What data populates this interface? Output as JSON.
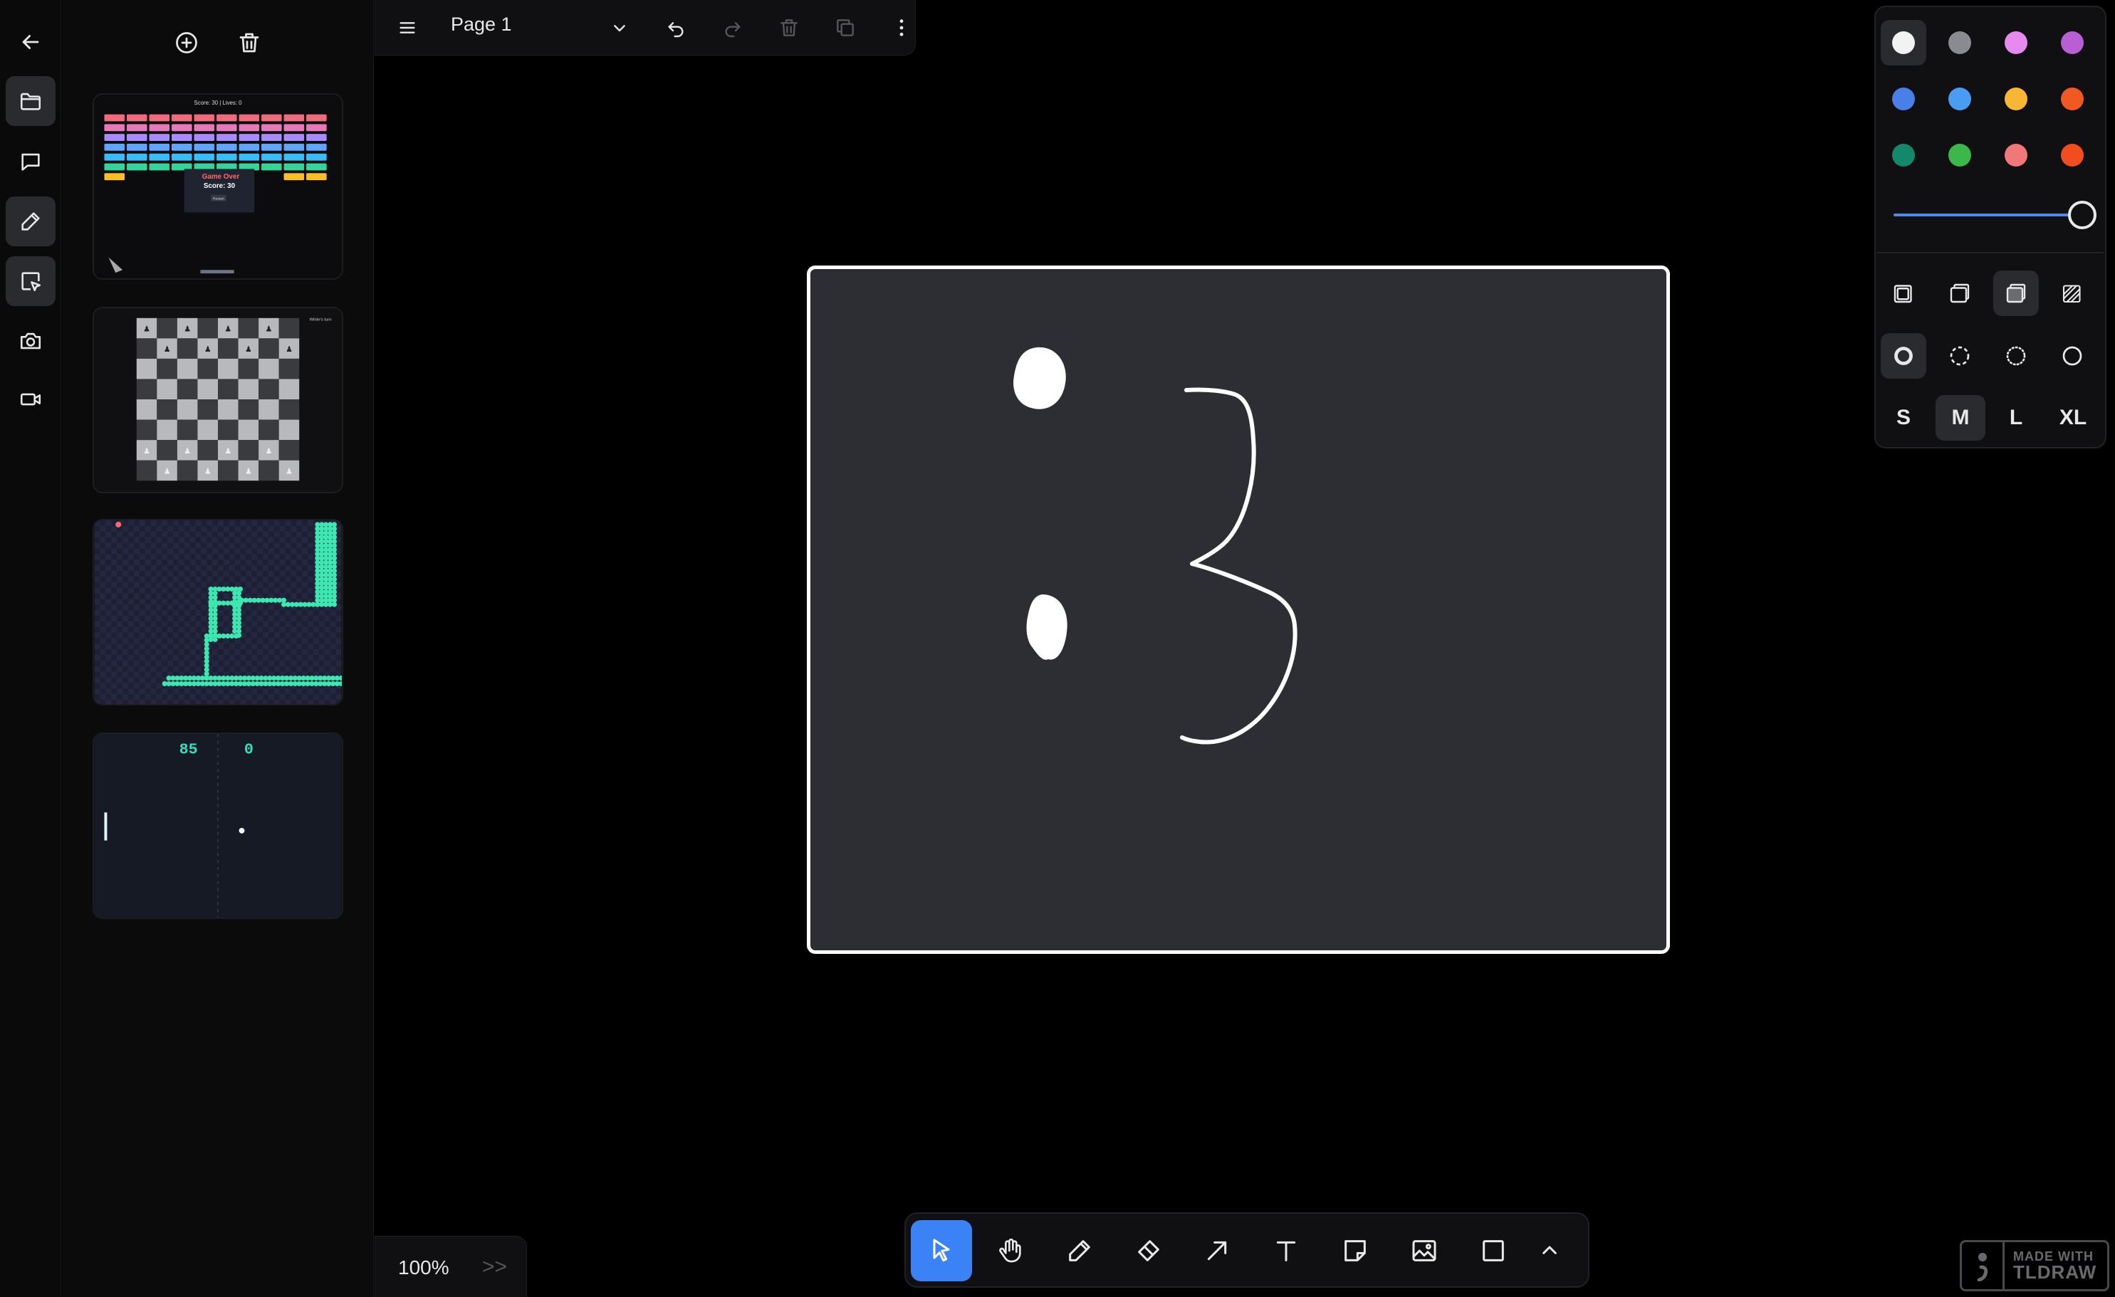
{
  "rail": {
    "items": [
      {
        "name": "back",
        "icon": "arrow-left-icon",
        "active": false
      },
      {
        "name": "files",
        "icon": "folder-icon",
        "active": true
      },
      {
        "name": "comments",
        "icon": "chat-icon",
        "active": false
      },
      {
        "name": "draw",
        "icon": "pencil-icon",
        "active": true
      },
      {
        "name": "select-edit",
        "icon": "pointer-square-icon",
        "active": true
      },
      {
        "name": "camera",
        "icon": "camera-icon",
        "active": false
      },
      {
        "name": "video",
        "icon": "video-icon",
        "active": false
      }
    ]
  },
  "pages_panel": {
    "add_icon": "plus-circle-icon",
    "delete_icon": "trash-icon",
    "thumbnails": [
      {
        "name": "breakout",
        "score_text": "Score: 30  |  Lives: 0",
        "overlay_title": "Game Over",
        "overlay_score": "Score: 30",
        "overlay_button": "Restart"
      },
      {
        "name": "checkers",
        "corner_text": "White's turn"
      },
      {
        "name": "snake"
      },
      {
        "name": "pong",
        "score_left": "85",
        "score_right": "0"
      }
    ]
  },
  "topbar": {
    "page_name": "Page 1",
    "icons": [
      "menu-icon",
      "chevron-down-icon",
      "undo-icon",
      "redo-icon",
      "trash-icon",
      "duplicate-icon",
      "more-vertical-icon"
    ]
  },
  "style_panel": {
    "colors": [
      {
        "name": "white",
        "hex": "#f2f2f2",
        "selected": true
      },
      {
        "name": "grey",
        "hex": "#8a8b90"
      },
      {
        "name": "light-violet",
        "hex": "#e78af0"
      },
      {
        "name": "violet",
        "hex": "#b95fd6"
      },
      {
        "name": "blue",
        "hex": "#4a7fe8"
      },
      {
        "name": "light-blue",
        "hex": "#4a9bf2"
      },
      {
        "name": "yellow",
        "hex": "#f7b733"
      },
      {
        "name": "orange",
        "hex": "#f05a22"
      },
      {
        "name": "green",
        "hex": "#13886a"
      },
      {
        "name": "light-green",
        "hex": "#3cb84a"
      },
      {
        "name": "light-red",
        "hex": "#f07878"
      },
      {
        "name": "red",
        "hex": "#f04e1e"
      }
    ],
    "opacity": 1.0,
    "fill_icons": [
      "fill-none-icon",
      "fill-semi-icon",
      "fill-solid-icon",
      "fill-pattern-icon"
    ],
    "fill_selected": 2,
    "dash_icons": [
      "dash-draw-icon",
      "dash-dashed-icon",
      "dash-dotted-icon",
      "dash-solid-icon"
    ],
    "dash_selected": 0,
    "sizes": [
      "S",
      "M",
      "L",
      "XL"
    ],
    "size_selected": "M"
  },
  "toolbar": {
    "tools": [
      {
        "name": "select",
        "icon": "cursor-icon",
        "active": true
      },
      {
        "name": "hand",
        "icon": "hand-icon"
      },
      {
        "name": "draw",
        "icon": "pencil-icon"
      },
      {
        "name": "eraser",
        "icon": "eraser-icon"
      },
      {
        "name": "arrow",
        "icon": "arrow-icon"
      },
      {
        "name": "text",
        "icon": "text-icon"
      },
      {
        "name": "note",
        "icon": "note-icon"
      },
      {
        "name": "media",
        "icon": "image-icon"
      },
      {
        "name": "rectangle",
        "icon": "rectangle-icon"
      },
      {
        "name": "more",
        "icon": "chevron-up-icon"
      }
    ]
  },
  "zoom": {
    "label": "100%",
    "more": ">>"
  },
  "watermark": {
    "line1": "MADE WITH",
    "line2": "TLDRAW"
  }
}
